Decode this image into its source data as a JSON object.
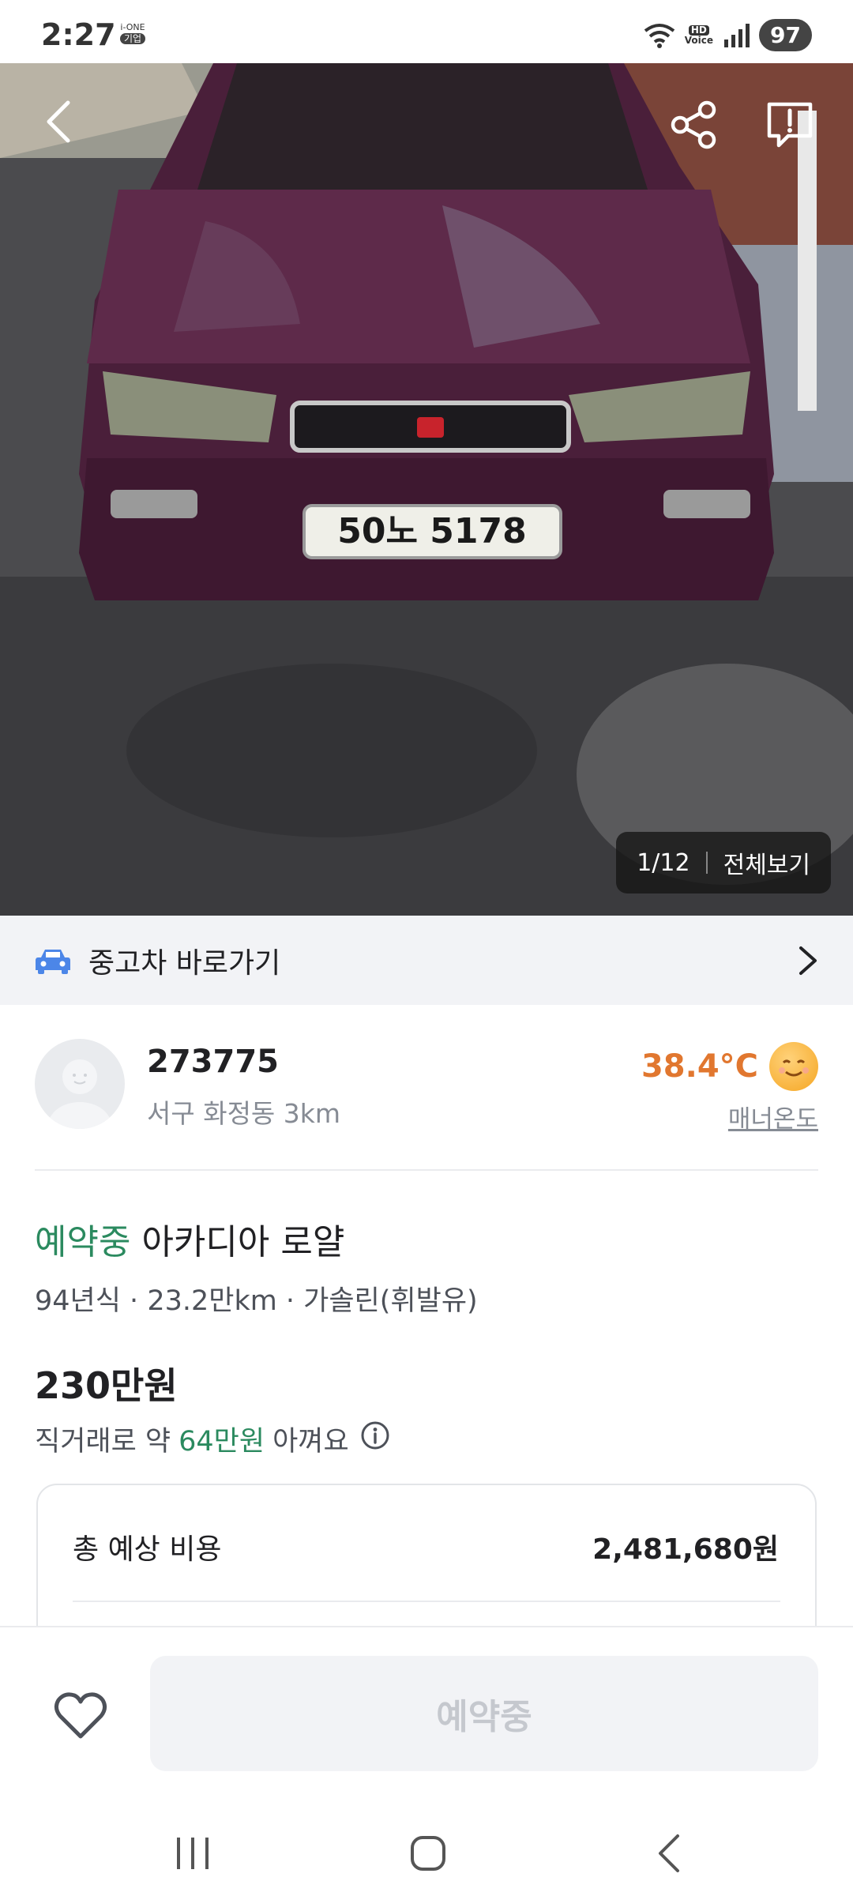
{
  "status_bar": {
    "time": "2:27",
    "carrier_top": "i-ONE",
    "carrier_bottom": "기업",
    "hd": "HD",
    "voice": "Voice",
    "battery": "97"
  },
  "gallery": {
    "counter": "1/12",
    "view_all": "전체보기",
    "plate": "50노 5178"
  },
  "car_shortcut": {
    "label": "중고차 바로가기"
  },
  "seller": {
    "name": "273775",
    "location": "서구 화정동 3km",
    "temperature": "38.4°C",
    "manner_label": "매너온도"
  },
  "listing": {
    "status": "예약중",
    "title": "아카디아 로얄",
    "specs": "94년식 · 23.2만km · 가솔린(휘발유)",
    "price": "230만원",
    "saving_prefix": "직거래로 약",
    "saving_amount": "64만원",
    "saving_suffix": "아껴요"
  },
  "cost_card": {
    "label": "총 예상 비용",
    "value": "2,481,680원"
  },
  "bottom_bar": {
    "action_label": "예약중"
  },
  "colors": {
    "accent_green": "#2b8a5f",
    "temperature_orange": "#e1772f",
    "car_icon_blue": "#4c86e8"
  }
}
